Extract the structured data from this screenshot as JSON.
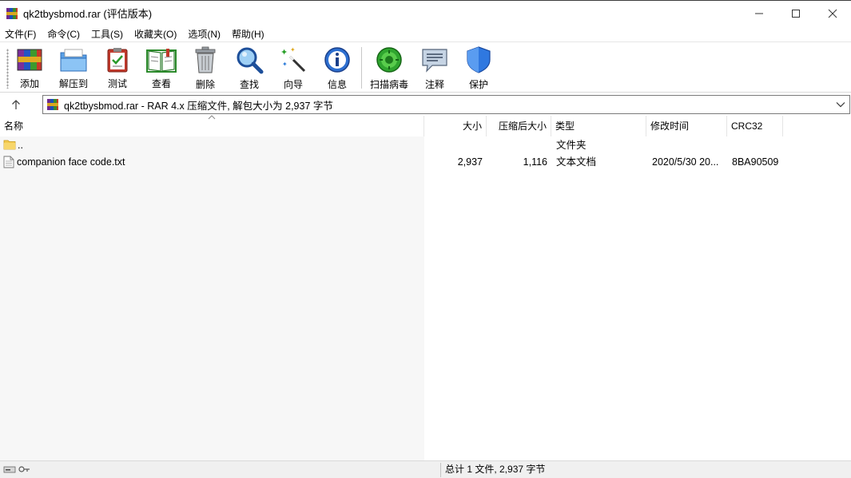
{
  "window": {
    "title": "qk2tbysbmod.rar (评估版本)"
  },
  "menu": [
    "文件(F)",
    "命令(C)",
    "工具(S)",
    "收藏夹(O)",
    "选项(N)",
    "帮助(H)"
  ],
  "toolbar": {
    "buttons": [
      {
        "label": "添加",
        "icon": "add-archive-icon"
      },
      {
        "label": "解压到",
        "icon": "extract-folder-icon"
      },
      {
        "label": "测试",
        "icon": "test-clipboard-icon"
      },
      {
        "label": "查看",
        "icon": "view-book-icon"
      },
      {
        "label": "删除",
        "icon": "trash-icon"
      },
      {
        "label": "查找",
        "icon": "magnifier-icon"
      },
      {
        "label": "向导",
        "icon": "wizard-wand-icon"
      },
      {
        "label": "信息",
        "icon": "info-icon"
      },
      {
        "label": "扫描病毒",
        "icon": "virus-scan-icon"
      },
      {
        "label": "注释",
        "icon": "comment-icon"
      },
      {
        "label": "保护",
        "icon": "shield-icon"
      }
    ]
  },
  "address": {
    "text": "qk2tbysbmod.rar - RAR 4.x 压缩文件, 解包大小为 2,937 字节"
  },
  "columns": {
    "name": "名称",
    "size": "大小",
    "packed": "压缩后大小",
    "type": "类型",
    "modified": "修改时间",
    "crc": "CRC32"
  },
  "rows": [
    {
      "name": "..",
      "size": "",
      "packed": "",
      "type": "文件夹",
      "modified": "",
      "crc": "",
      "icon": "folder-icon"
    },
    {
      "name": "companion face code.txt",
      "size": "2,937",
      "packed": "1,116",
      "type": "文本文档",
      "modified": "2020/5/30 20...",
      "crc": "8BA90509",
      "icon": "text-file-icon"
    }
  ],
  "status": {
    "summary": "总计 1 文件, 2,937 字节"
  },
  "colors": {
    "accent_blue": "#1e6fd9",
    "list_bg": "#f7f7f7",
    "status_bg": "#f0f0f0"
  }
}
